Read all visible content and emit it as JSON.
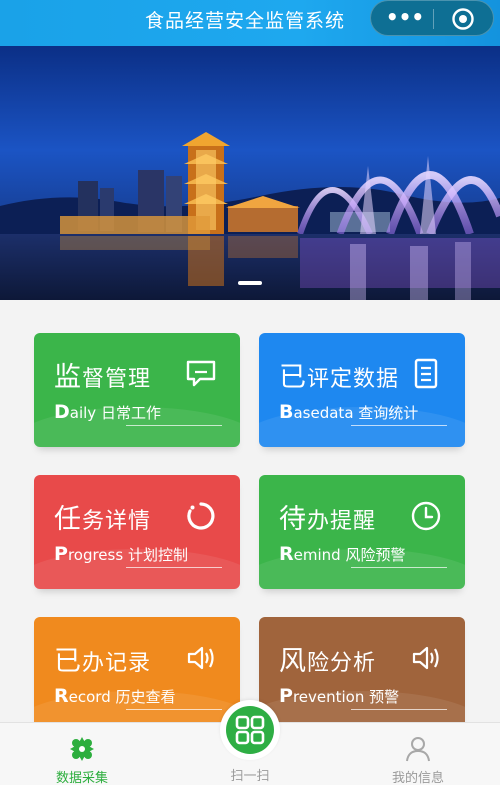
{
  "header": {
    "title": "食品经营安全监管系统",
    "more_icon": "more-dots-icon",
    "close_icon": "target-circle-icon"
  },
  "banner": {
    "image": "city-night-fountain-banner",
    "indicator_count": 1
  },
  "tiles": [
    {
      "title_first": "监",
      "title_rest": "督管理",
      "sub_cap": "D",
      "sub_rest": "aily 日常工作",
      "icon": "chat-bubble-icon",
      "color": "#3bb54a"
    },
    {
      "title_first": "已",
      "title_rest": "评定数据",
      "sub_cap": "B",
      "sub_rest": "asedata 查询统计",
      "icon": "document-list-icon",
      "color": "#1e88f0"
    },
    {
      "title_first": "任",
      "title_rest": "务详情",
      "sub_cap": "P",
      "sub_rest": "rogress 计划控制",
      "icon": "loading-arc-icon",
      "color": "#e84a4a"
    },
    {
      "title_first": "待",
      "title_rest": "办提醒",
      "sub_cap": "R",
      "sub_rest": "emind 风险预警",
      "icon": "clock-icon",
      "color": "#3bb54a"
    },
    {
      "title_first": "已",
      "title_rest": "办记录",
      "sub_cap": "R",
      "sub_rest": "ecord 历史查看",
      "icon": "speaker-icon",
      "color": "#f08a1e"
    },
    {
      "title_first": "风",
      "title_rest": "险分析",
      "sub_cap": "P",
      "sub_rest": "revention 预警",
      "icon": "speaker-icon",
      "color": "#a0643c"
    }
  ],
  "tabbar": {
    "tabs": [
      {
        "label": "数据采集",
        "icon": "data-collect-icon",
        "active": true
      },
      {
        "label": "扫一扫",
        "icon": "scan-grid-icon",
        "active": false
      },
      {
        "label": "我的信息",
        "icon": "user-icon",
        "active": false
      }
    ]
  },
  "colors": {
    "header": "#1ea8ef",
    "active_tab": "#2dae3e",
    "inactive_tab": "#9a9a9a"
  }
}
